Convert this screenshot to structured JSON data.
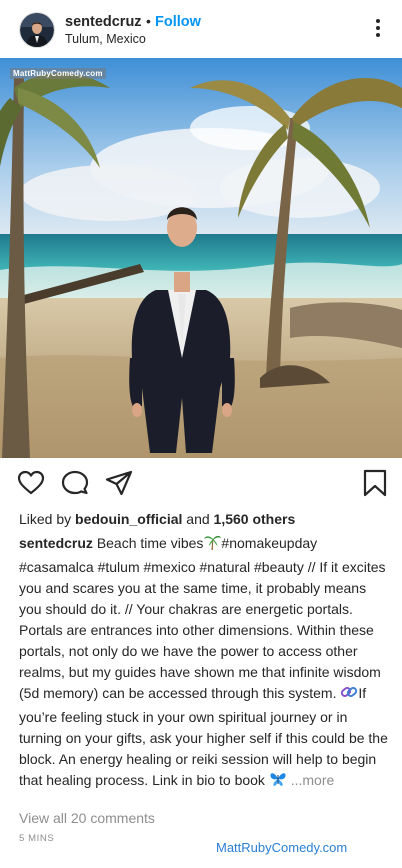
{
  "post": {
    "username": "sentedcruz",
    "separator": "•",
    "follow_label": "Follow",
    "location": "Tulum, Mexico"
  },
  "image": {
    "watermark": "MattRubyComedy.com"
  },
  "actions": {
    "icons": [
      "heart-icon",
      "comment-icon",
      "share-icon",
      "bookmark-icon"
    ]
  },
  "likes": {
    "prefix": "Liked by",
    "user": "bedouin_official",
    "middle": "and",
    "count": "1,560 others"
  },
  "caption": {
    "username": "sentedcruz",
    "part1": "Beach time vibes",
    "part2": "#nomakeupday #casamalca #tulum #mexico #natural #beauty // If it excites you and scares you at the same time, it probably means you should do it. // Your chakras are energetic portals. Portals are entrances into other dimensions. Within these portals, not only do we have the power to access other realms, but my guides have shown me that infinite wisdom (5d memory) can be accessed through this system.",
    "part3": "If you’re feeling stuck in your own spiritual journey or in turning on your gifts, ask your higher self if this could be the block. An energy healing or reiki session will help to begin that healing process. Link in bio to book",
    "more_label": "...more"
  },
  "comments": {
    "view_all": "View all 20 comments"
  },
  "time_ago": "5 MINS",
  "footer_watermark": "MattRubyComedy.com",
  "colors": {
    "link_blue": "#0095f6",
    "muted": "#8e8e8e",
    "text": "#262626",
    "watermark_blue": "#2a7fd4"
  }
}
